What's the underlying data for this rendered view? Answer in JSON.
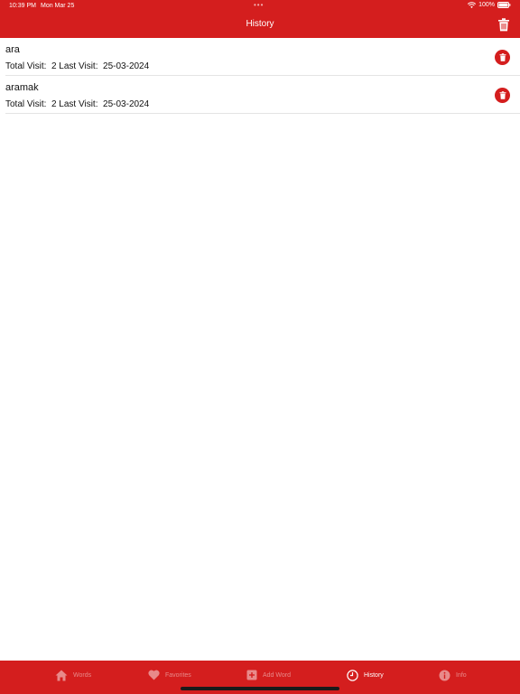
{
  "status_bar": {
    "time": "10:39 PM",
    "date": "Mon Mar 25",
    "dots": "•••",
    "battery": "100%"
  },
  "nav": {
    "title": "History"
  },
  "history": [
    {
      "word": "ara",
      "total_label": "Total Visit:",
      "total": "2",
      "last_label": "Last Visit:",
      "last": "25-03-2024"
    },
    {
      "word": "aramak",
      "total_label": "Total Visit:",
      "total": "2",
      "last_label": "Last Visit:",
      "last": "25-03-2024"
    }
  ],
  "tabs": [
    {
      "label": "Words",
      "icon": "home-icon",
      "active": false
    },
    {
      "label": "Favorites",
      "icon": "heart-icon",
      "active": false
    },
    {
      "label": "Add Word",
      "icon": "plus-square-icon",
      "active": false
    },
    {
      "label": "History",
      "icon": "clock-icon",
      "active": true
    },
    {
      "label": "Info",
      "icon": "info-icon",
      "active": false
    }
  ],
  "colors": {
    "primary": "#d41e1e",
    "inactive_tab": "#e88a8a"
  }
}
